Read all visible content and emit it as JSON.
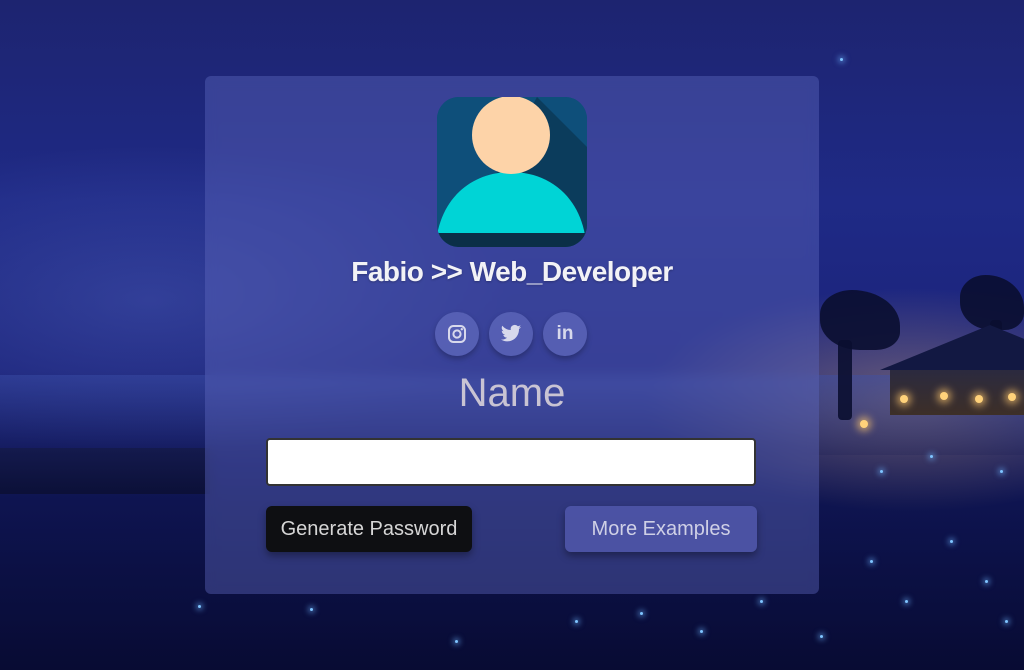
{
  "profile": {
    "handle": "Fabio >> Web_Developer",
    "avatar_icon": "user-avatar-icon"
  },
  "socials": [
    {
      "icon": "instagram-icon"
    },
    {
      "icon": "twitter-icon"
    },
    {
      "icon": "linkedin-icon",
      "glyph": "in"
    }
  ],
  "form": {
    "label": "Name",
    "name_value": "",
    "name_placeholder": ""
  },
  "buttons": {
    "generate_label": "Generate Password",
    "more_label": "More Examples"
  },
  "colors": {
    "card": "#5f69be",
    "avatar_bg": "#0e4f7a",
    "avatar_head": "#fdd3a8",
    "avatar_body": "#00d4d6",
    "generate_bg": "#0e0f12",
    "more_bg": "#5058aa"
  }
}
